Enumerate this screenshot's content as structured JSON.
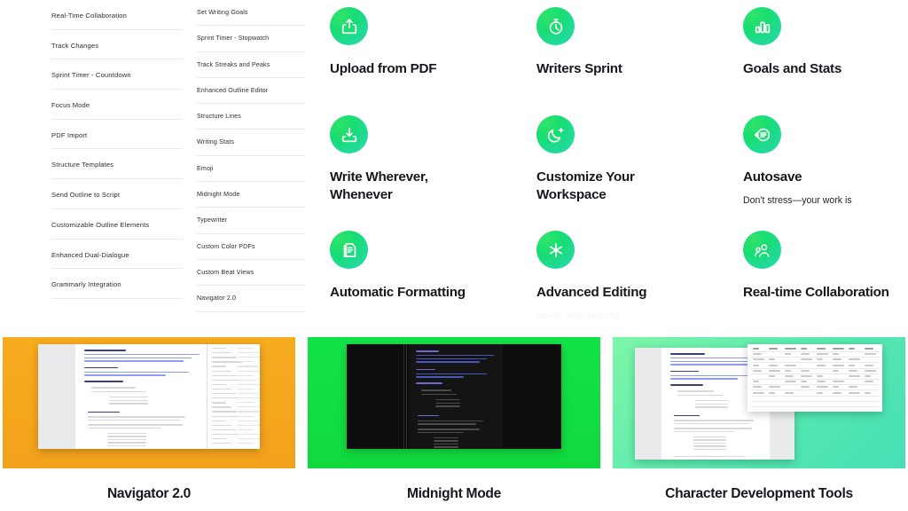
{
  "feature_lists": {
    "column_1": [
      "Real-Time Collaboration",
      "Track Changes",
      "Sprint Timer - Countdown",
      "Focus Mode",
      "PDF Import",
      "Structure Templates",
      "Send Outline to Script",
      "Customizable Outline Elements",
      "Enhanced Dual-Dialogue",
      "Grammarly Integration"
    ],
    "column_2": [
      "Set Writing Goals",
      "Sprint Timer - Stopwatch",
      "Track Streaks and Peaks",
      "Enhanced Outline Editor",
      "Structure Lines",
      "Writing Stats",
      "Emoji",
      "Midnight Mode",
      "Typewriter",
      "Custom Color PDFs",
      "Custom Beat Views",
      "Navigator 2.0"
    ]
  },
  "features": [
    {
      "icon": "upload-icon",
      "title": "Upload from PDF",
      "body": ""
    },
    {
      "icon": "stopwatch-icon",
      "title": "Writers Sprint",
      "body": ""
    },
    {
      "icon": "bar-chart-icon",
      "title": "Goals and Stats",
      "body": ""
    },
    {
      "icon": "download-icon",
      "title": "Write Wherever, Whenever",
      "body": ""
    },
    {
      "icon": "moon-star-icon",
      "title": "Customize Your Workspace",
      "body": ""
    },
    {
      "icon": "autosave-icon",
      "title": "Autosave",
      "body": "Don't stress—your work is"
    },
    {
      "icon": "document-icon",
      "title": "Automatic Formatting",
      "body": ""
    },
    {
      "icon": "asterisk-icon",
      "title": "Advanced Editing",
      "body": "saved automatically"
    },
    {
      "icon": "collaboration-icon",
      "title": "Real-time Collaboration",
      "body": ""
    }
  ],
  "showcases": [
    {
      "caption": "Navigator 2.0",
      "color": "#f5a623"
    },
    {
      "caption": "Midnight Mode",
      "color": "#16e049"
    },
    {
      "caption": "Character Development Tools",
      "color": "#57e8b0"
    }
  ],
  "colors": {
    "icon_gradient_start": "#2fe36a",
    "icon_gradient_end": "#2fd6b6",
    "text": "#16181c",
    "rule": "#e9eaec"
  }
}
